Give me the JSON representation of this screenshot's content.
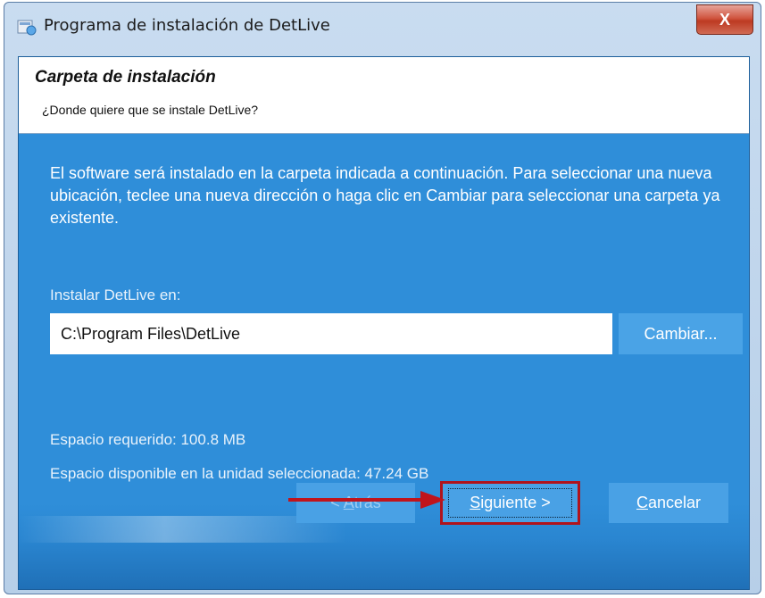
{
  "window": {
    "title": "Programa de instalación de DetLive",
    "close_label": "X"
  },
  "header": {
    "title": "Carpeta de instalación",
    "subtitle": "¿Donde quiere que se instale DetLive?"
  },
  "body": {
    "description": "El software será instalado en la carpeta indicada a continuación. Para seleccionar una nueva ubicación, teclee una nueva dirección o haga clic en Cambiar para seleccionar una carpeta ya existente.",
    "install_label": "Instalar DetLive en:",
    "install_path": "C:\\Program Files\\DetLive",
    "change_button": "Cambiar...",
    "space_required": "Espacio requerido: 100.8 MB",
    "space_available": "Espacio disponible en la unidad seleccionada: 47.24 GB"
  },
  "footer": {
    "back_prefix": "< ",
    "back_accel": "A",
    "back_rest": "trás",
    "next_accel": "S",
    "next_rest": "iguiente >",
    "cancel_accel": "C",
    "cancel_rest": "ancelar"
  },
  "colors": {
    "panel_blue": "#2f8ed9",
    "button_blue": "#49a1e5",
    "highlight_red": "#b0131c"
  }
}
